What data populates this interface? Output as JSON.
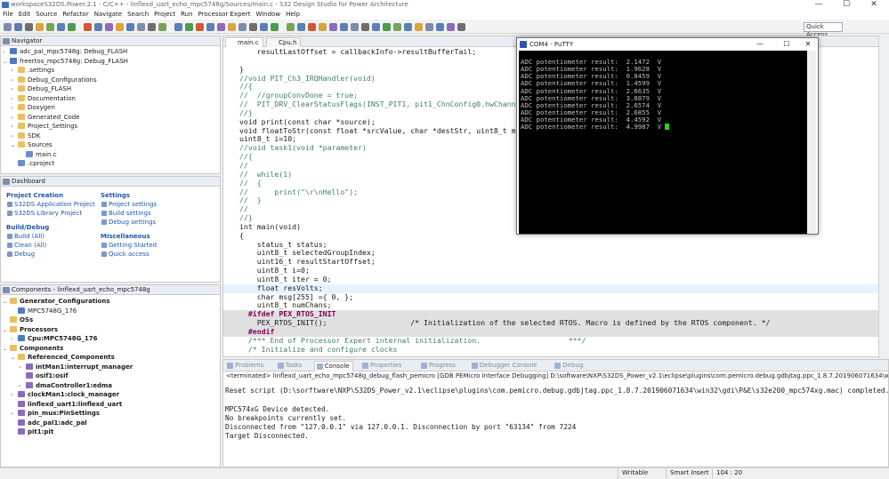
{
  "window": {
    "title": "workspaceS32DS.Power.2.1 - C/C++ - linflexd_uart_echo_mpc5748g/Sources/main.c - S32 Design Studio for Power Architecture",
    "controls": {
      "minimize": "—",
      "maximize": "☐",
      "close": "✕"
    }
  },
  "menu": [
    "File",
    "Edit",
    "Source",
    "Refactor",
    "Navigate",
    "Search",
    "Project",
    "Run",
    "Processor Expert",
    "Window",
    "Help"
  ],
  "toolbar": {
    "quick_access": "Quick Access"
  },
  "navigator": {
    "title": "Navigator",
    "items": [
      {
        "label": "adc_pal_mpc5748g: Debug_FLASH",
        "indent": 0,
        "icon": "project-icon",
        "arrow": "›"
      },
      {
        "label": "freertos_mpc5748g: Debug_FLASH",
        "indent": 0,
        "icon": "project-icon",
        "arrow": "⌄"
      },
      {
        "label": ".settings",
        "indent": 1,
        "icon": "folder-icon",
        "arrow": "›"
      },
      {
        "label": "Debug_Configurations",
        "indent": 1,
        "icon": "folder-icon",
        "arrow": "›"
      },
      {
        "label": "Debug_FLASH",
        "indent": 1,
        "icon": "folder-icon",
        "arrow": "›"
      },
      {
        "label": "Documentation",
        "indent": 1,
        "icon": "folder-icon",
        "arrow": "›"
      },
      {
        "label": "Doxygen",
        "indent": 1,
        "icon": "folder-icon",
        "arrow": "›"
      },
      {
        "label": "Generated_Code",
        "indent": 1,
        "icon": "folder-icon",
        "arrow": "›"
      },
      {
        "label": "Project_Settings",
        "indent": 1,
        "icon": "folder-icon",
        "arrow": "›"
      },
      {
        "label": "SDK",
        "indent": 1,
        "icon": "folder-icon",
        "arrow": "›"
      },
      {
        "label": "Sources",
        "indent": 1,
        "icon": "folder-icon",
        "arrow": "⌄"
      },
      {
        "label": "main.c",
        "indent": 2,
        "icon": "c-file-icon",
        "arrow": ""
      },
      {
        "label": ".cproject",
        "indent": 1,
        "icon": "file-icon",
        "arrow": ""
      }
    ]
  },
  "dashboard": {
    "title": "Dashboard",
    "project_creation": {
      "heading": "Project Creation",
      "links": [
        "S32DS Application Project",
        "S32DS Library Project"
      ]
    },
    "settings": {
      "heading": "Settings",
      "links": [
        "Project settings",
        "Build settings",
        "Debug settings"
      ]
    },
    "build_debug": {
      "heading": "Build/Debug",
      "links": [
        "Build  (All)",
        "Clean  (All)",
        "Debug"
      ]
    },
    "misc": {
      "heading": "Miscellaneous",
      "links": [
        "Getting Started",
        "Quick access"
      ]
    }
  },
  "components": {
    "title": "Components - linflexd_uart_echo_mpc5748g",
    "items": [
      {
        "label": "Generator_Configurations",
        "indent": 0,
        "bold": true,
        "arrow": "⌄",
        "icon": "folder-icon"
      },
      {
        "label": "MPC5748G_176",
        "indent": 1,
        "bold": false,
        "arrow": "",
        "icon": "chip-icon"
      },
      {
        "label": "OSs",
        "indent": 0,
        "bold": true,
        "arrow": "",
        "icon": "folder-icon"
      },
      {
        "label": "Processors",
        "indent": 0,
        "bold": true,
        "arrow": "⌄",
        "icon": "folder-icon"
      },
      {
        "label": "Cpu:MPC5748G_176",
        "indent": 1,
        "bold": true,
        "arrow": "›",
        "icon": "chip-icon"
      },
      {
        "label": "Components",
        "indent": 0,
        "bold": true,
        "arrow": "⌄",
        "icon": "folder-icon"
      },
      {
        "label": "Referenced_Components",
        "indent": 1,
        "bold": true,
        "arrow": "⌄",
        "icon": "folder-icon"
      },
      {
        "label": "intMan1:interrupt_manager",
        "indent": 2,
        "bold": true,
        "arrow": "›",
        "icon": "component-icon"
      },
      {
        "label": "osif1:osif",
        "indent": 2,
        "bold": true,
        "arrow": "",
        "icon": "component-icon"
      },
      {
        "label": "dmaController1:edma",
        "indent": 2,
        "bold": true,
        "arrow": "›",
        "icon": "component-icon"
      },
      {
        "label": "clockMan1:clock_manager",
        "indent": 1,
        "bold": true,
        "arrow": "›",
        "icon": "component-icon"
      },
      {
        "label": "linflexd_uart1:linflexd_uart",
        "indent": 1,
        "bold": true,
        "arrow": "",
        "icon": "component-icon"
      },
      {
        "label": "pin_mux:PinSettings",
        "indent": 1,
        "bold": true,
        "arrow": "›",
        "icon": "component-icon"
      },
      {
        "label": "adc_pal1:adc_pal",
        "indent": 1,
        "bold": true,
        "arrow": "",
        "icon": "component-icon"
      },
      {
        "label": "pit1:pit",
        "indent": 1,
        "bold": true,
        "arrow": "",
        "icon": "component-icon"
      }
    ]
  },
  "editor": {
    "tabs": [
      "main.c",
      "Cpu.h"
    ],
    "lines": [
      {
        "text": "    resultLastOffset = callbackInfo->resultBufferTail;",
        "style": ""
      },
      {
        "text": "",
        "style": ""
      },
      {
        "text": "}",
        "style": ""
      },
      {
        "text": "//void PIT_Ch3_IRQHandler(void)",
        "style": "cm"
      },
      {
        "text": "//{",
        "style": "cm"
      },
      {
        "text": "//  //groupConvDone = true;",
        "style": "cm"
      },
      {
        "text": "//  PIT_DRV_ClearStatusFlags(INST_PIT1, pit1_ChnConfig0.hwChannel);",
        "style": "cm"
      },
      {
        "text": "//}",
        "style": "cm"
      },
      {
        "text": "void print(const char *source);",
        "style": "decl"
      },
      {
        "text": "void floatToStr(const float *srcValue, char *destStr, uint8_t maxLen);",
        "style": "decl"
      },
      {
        "text": "uint8_t i=10;",
        "style": ""
      },
      {
        "text": "//void task1(void *parameter)",
        "style": "cm"
      },
      {
        "text": "//{",
        "style": "cm"
      },
      {
        "text": "//",
        "style": "cm"
      },
      {
        "text": "//  while(1)",
        "style": "cm"
      },
      {
        "text": "//  {",
        "style": "cm"
      },
      {
        "text": "//      print(\"\\r\\nHello\");",
        "style": "cm"
      },
      {
        "text": "//  }",
        "style": "cm"
      },
      {
        "text": "//",
        "style": "cm"
      },
      {
        "text": "//}",
        "style": "cm"
      },
      {
        "text": "int main(void)",
        "style": "decl"
      },
      {
        "text": "{",
        "style": ""
      },
      {
        "text": "    status_t status;",
        "style": ""
      },
      {
        "text": "    uint8_t selectedGroupIndex;",
        "style": ""
      },
      {
        "text": "    uint16_t resultStartOffset;",
        "style": ""
      },
      {
        "text": "    uint8_t i=0;",
        "style": ""
      },
      {
        "text": "    uint8_t iter = 0;",
        "style": ""
      },
      {
        "text": "    float resVolts;",
        "style": "cur"
      },
      {
        "text": "    char msg[255] ={ 0, };",
        "style": ""
      },
      {
        "text": "    uint8_t numChans;",
        "style": ""
      },
      {
        "text": "  #ifdef PEX_RTOS_INIT",
        "style": "pp"
      },
      {
        "text": "    PEX_RTOS_INIT();                   /* Initialization of the selected RTOS. Macro is defined by the RTOS component. */",
        "style": "ppbody"
      },
      {
        "text": "  #endif",
        "style": "pp"
      },
      {
        "text": "  /*** End of Processor Expert internal initialization.                    ***/",
        "style": "cm"
      },
      {
        "text": "  /* Initialize and configure clocks",
        "style": "cm"
      }
    ]
  },
  "putty": {
    "title": "COM4 - PuTTY",
    "lines": [
      "ADC potentiometer result:  2.1472  V",
      "ADC potentiometer result:  1.9628  V",
      "ADC potentiometer result:  0.8459  V",
      "ADC potentiometer result:  1.4599  V",
      "ADC potentiometer result:  2.6635  V",
      "ADC potentiometer result:  3.8879  V",
      "ADC potentiometer result:  2.6574  V",
      "ADC potentiometer result:  2.6855  V",
      "ADC potentiometer result:  4.4592  V",
      "ADC potentiometer result:  4.9987  V"
    ]
  },
  "bottom": {
    "tabs": [
      "Problems",
      "Tasks",
      "Console",
      "Properties",
      "Progress",
      "Debugger Console",
      "Debug"
    ],
    "active_tab": "Console",
    "terminated": "<terminated> linflexd_uart_echo_mpc5748g_debug_flash_pemicro [GDB PEMicro Interface Debugging] D:\\software\\NXP\\S32DS_Power_v2.1\\eclipse\\plugins\\com.pemicro.debug.gdbjtag.ppc_1.8.7.201906071634\\win32\\pegdbserver_power_console.exe",
    "console_lines": [
      "Reset script (D:\\sorftware\\NXP\\S32DS_Power_v2.1\\eclipse\\plugins\\com.pemicro.debug.gdbjtag.ppc_1.8.7.201906071634\\win32\\gdi\\P&E\\s32e200_mpc574xg.mac) completed.",
      "",
      "MPC574xG Device detected.",
      "No breakpoints currently set.",
      "Disconnected from \"127.0.0.1\" via 127.0.0.1. Disconnection by port \"63134\" from 7224",
      "Target Disconnected."
    ]
  },
  "status": {
    "writable": "Writable",
    "insert": "Smart Insert",
    "position": "104 : 20"
  }
}
